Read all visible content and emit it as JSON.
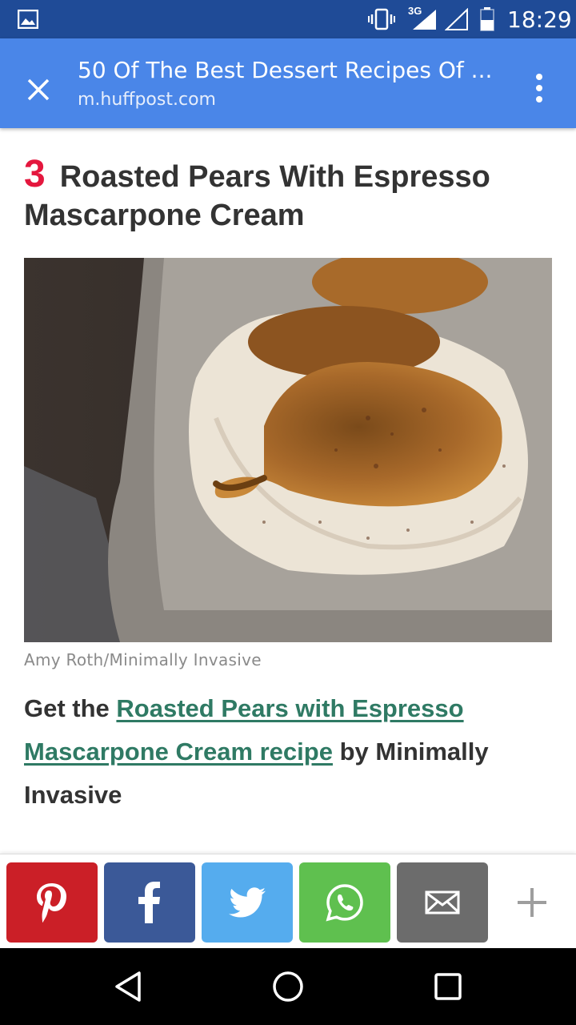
{
  "status_bar": {
    "network": "3G",
    "time": "18:29"
  },
  "toolbar": {
    "title": "50 Of The Best Dessert Recipes Of ...",
    "url": "m.huffpost.com"
  },
  "article": {
    "slide_number": "3",
    "slide_title": "Roasted Pears With Espresso Mascarpone Cream",
    "photo_credit": "Amy Roth/Minimally Invasive",
    "recipe_prefix": "Get the",
    "recipe_link": "Roasted Pears with Espresso Mascarpone Cream recipe",
    "recipe_suffix": "by Minimally Invasive"
  },
  "share_bar": {
    "buttons": [
      {
        "name": "pinterest",
        "icon": "pinterest-icon",
        "color": "#cb1f27"
      },
      {
        "name": "facebook",
        "icon": "facebook-icon",
        "color": "#3b5998"
      },
      {
        "name": "twitter",
        "icon": "twitter-icon",
        "color": "#55acee"
      },
      {
        "name": "whatsapp",
        "icon": "whatsapp-icon",
        "color": "#5fc04f"
      },
      {
        "name": "email",
        "icon": "mail-icon",
        "color": "#6c6c6c"
      },
      {
        "name": "more",
        "icon": "plus-icon",
        "color": "#9e9e9e"
      }
    ]
  },
  "colors": {
    "status_bar": "#1f4b97",
    "toolbar": "#4a86e8",
    "slide_number": "#e4173e",
    "link": "#2f7a64",
    "heading": "#333333"
  }
}
